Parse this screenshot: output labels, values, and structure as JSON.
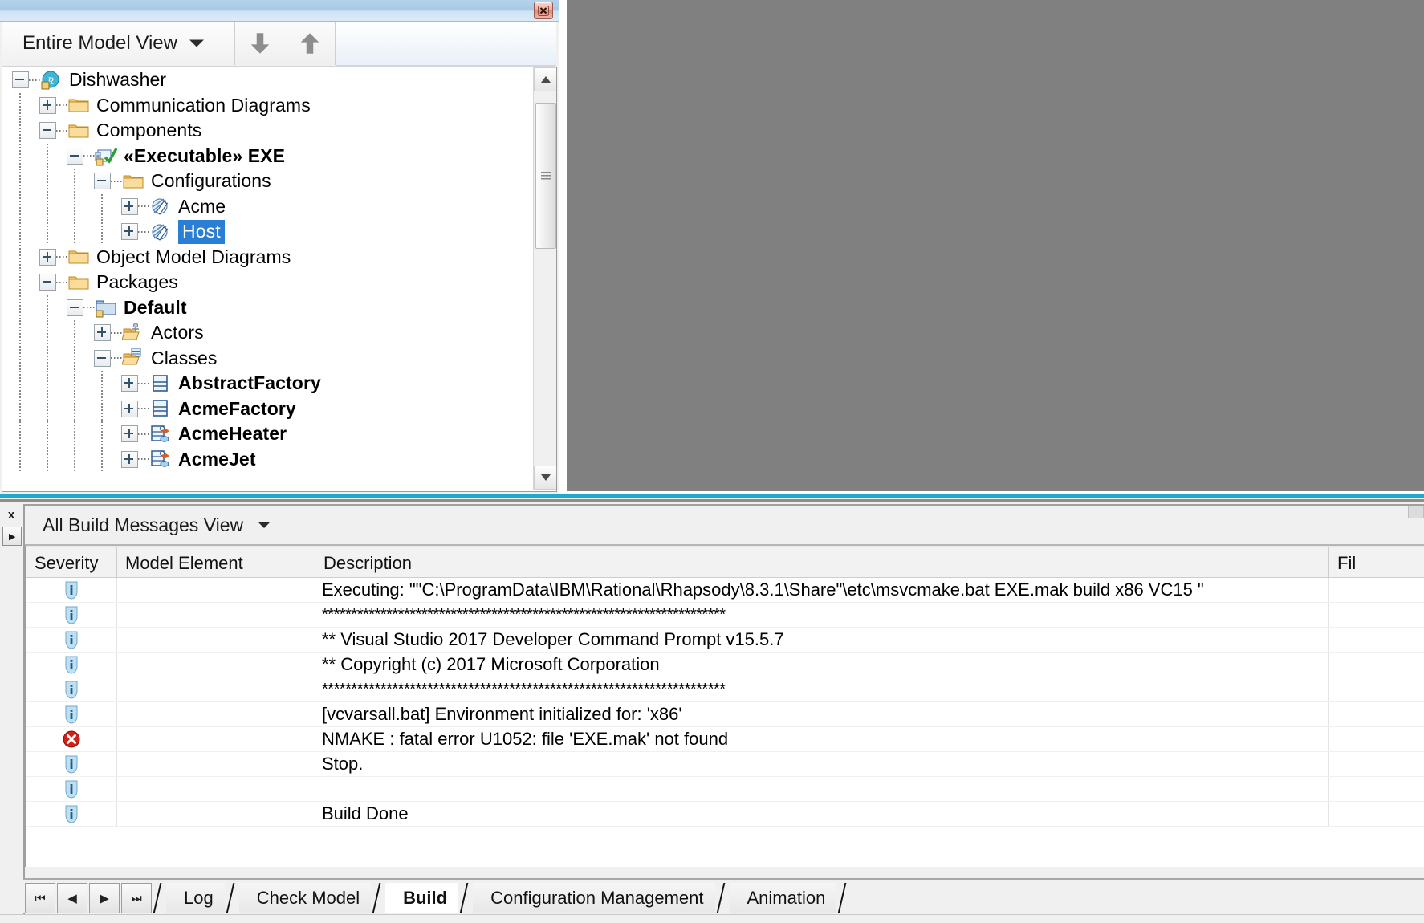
{
  "browser": {
    "title_close_label": "Close",
    "toolbar": {
      "view_selector_value": "Entire Model View",
      "nav_down_label": "Move Down",
      "nav_up_label": "Move Up"
    },
    "tree": [
      {
        "label": "Dishwasher",
        "depth": 0,
        "expander": "minus",
        "icon": "rhapsody-project-icon",
        "bold": false,
        "selected": false
      },
      {
        "label": "Communication Diagrams",
        "depth": 1,
        "expander": "plus",
        "icon": "folder-icon",
        "bold": false,
        "selected": false
      },
      {
        "label": "Components",
        "depth": 1,
        "expander": "minus",
        "icon": "folder-icon",
        "bold": false,
        "selected": false
      },
      {
        "label": "«Executable» EXE",
        "depth": 2,
        "expander": "minus",
        "icon": "component-check-icon",
        "bold": true,
        "selected": false
      },
      {
        "label": "Configurations",
        "depth": 3,
        "expander": "minus",
        "icon": "folder-icon",
        "bold": false,
        "selected": false
      },
      {
        "label": "Acme",
        "depth": 4,
        "expander": "plus",
        "icon": "configuration-icon",
        "bold": false,
        "selected": false
      },
      {
        "label": "Host",
        "depth": 4,
        "expander": "plus",
        "icon": "configuration-icon",
        "bold": false,
        "selected": true
      },
      {
        "label": "Object Model Diagrams",
        "depth": 1,
        "expander": "plus",
        "icon": "folder-icon",
        "bold": false,
        "selected": false
      },
      {
        "label": "Packages",
        "depth": 1,
        "expander": "minus",
        "icon": "folder-icon",
        "bold": false,
        "selected": false
      },
      {
        "label": "Default",
        "depth": 2,
        "expander": "minus",
        "icon": "package-icon",
        "bold": true,
        "selected": false
      },
      {
        "label": "Actors",
        "depth": 3,
        "expander": "plus",
        "icon": "actors-folder-icon",
        "bold": false,
        "selected": false
      },
      {
        "label": "Classes",
        "depth": 3,
        "expander": "minus",
        "icon": "classes-folder-icon",
        "bold": false,
        "selected": false
      },
      {
        "label": "AbstractFactory",
        "depth": 4,
        "expander": "plus",
        "icon": "class-icon",
        "bold": true,
        "selected": false
      },
      {
        "label": "AcmeFactory",
        "depth": 4,
        "expander": "plus",
        "icon": "class-icon",
        "bold": true,
        "selected": false
      },
      {
        "label": "AcmeHeater",
        "depth": 4,
        "expander": "plus",
        "icon": "object-class-icon",
        "bold": true,
        "selected": false
      },
      {
        "label": "AcmeJet",
        "depth": 4,
        "expander": "plus",
        "icon": "object-class-icon",
        "bold": true,
        "selected": false
      }
    ],
    "selection_color": "#2a7fd4"
  },
  "output": {
    "gutter": {
      "close_label": "x",
      "expand_label": "▸"
    },
    "view_selector_value": "All Build Messages View",
    "columns": [
      {
        "key": "severity",
        "label": "Severity"
      },
      {
        "key": "model_element",
        "label": "Model Element"
      },
      {
        "key": "description",
        "label": "Description"
      },
      {
        "key": "file",
        "label": "Fil"
      }
    ],
    "rows": [
      {
        "severity": "info",
        "model_element": "",
        "description": "Executing: \"\"C:\\ProgramData\\IBM\\Rational\\Rhapsody\\8.3.1\\Share\"\\etc\\msvcmake.bat EXE.mak build x86 VC15 \"",
        "file": ""
      },
      {
        "severity": "info",
        "model_element": "",
        "description": "*********************************************************************",
        "file": ""
      },
      {
        "severity": "info",
        "model_element": "",
        "description": "** Visual Studio 2017 Developer Command Prompt v15.5.7",
        "file": ""
      },
      {
        "severity": "info",
        "model_element": "",
        "description": "** Copyright (c) 2017 Microsoft Corporation",
        "file": ""
      },
      {
        "severity": "info",
        "model_element": "",
        "description": "*********************************************************************",
        "file": ""
      },
      {
        "severity": "info",
        "model_element": "",
        "description": "[vcvarsall.bat] Environment initialized for: 'x86'",
        "file": ""
      },
      {
        "severity": "error",
        "model_element": "",
        "description": "NMAKE : fatal error U1052: file 'EXE.mak' not found",
        "file": ""
      },
      {
        "severity": "info",
        "model_element": "",
        "description": "Stop.",
        "file": ""
      },
      {
        "severity": "info",
        "model_element": "",
        "description": "",
        "file": ""
      },
      {
        "severity": "info",
        "model_element": "",
        "description": "Build Done",
        "file": ""
      }
    ],
    "tabs": [
      {
        "label": "Log",
        "active": false
      },
      {
        "label": "Check Model",
        "active": false
      },
      {
        "label": "Build",
        "active": true
      },
      {
        "label": "Configuration Management",
        "active": false
      },
      {
        "label": "Animation",
        "active": false
      }
    ],
    "tab_nav": [
      {
        "name": "first",
        "glyph": "⏮"
      },
      {
        "name": "prev",
        "glyph": "◀"
      },
      {
        "name": "next",
        "glyph": "▶"
      },
      {
        "name": "last",
        "glyph": "⏭"
      }
    ],
    "error_color": "#d12a1f",
    "info_color": "#6ba8d8"
  }
}
